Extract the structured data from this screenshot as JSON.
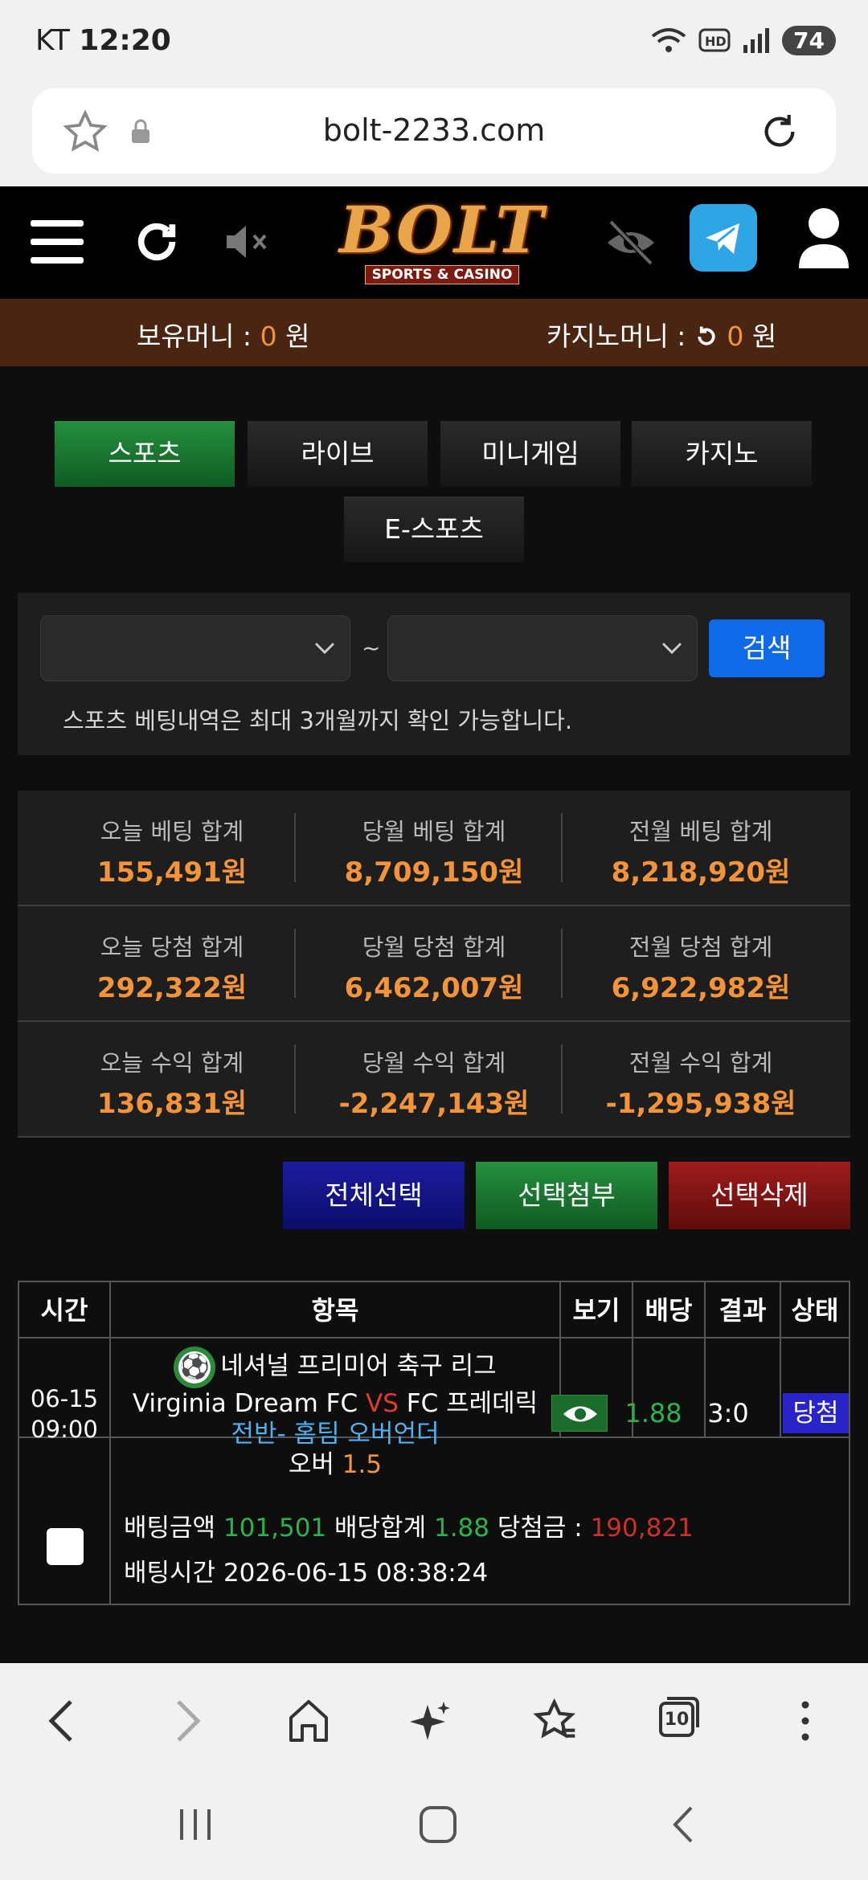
{
  "status": {
    "carrier": "KT",
    "time": "12:20",
    "battery": "74"
  },
  "browser": {
    "url": "bolt-2233.com"
  },
  "logo": {
    "title": "BOLT",
    "subtitle": "SPORTS & CASINO"
  },
  "money": {
    "holding_label": "보유머니 :",
    "holding_value": "0",
    "holding_unit": "원",
    "casino_label": "카지노머니 :",
    "casino_value": "0",
    "casino_unit": "원"
  },
  "tabs": [
    {
      "label": "스포츠",
      "active": true
    },
    {
      "label": "라이브"
    },
    {
      "label": "미니게임"
    },
    {
      "label": "카지노"
    },
    {
      "label": "E-스포츠"
    }
  ],
  "search": {
    "tilde": "~",
    "button": "검색",
    "note": "스포츠 베팅내역은 최대 3개월까지 확인 가능합니다."
  },
  "stats": [
    [
      {
        "label": "오늘 베팅 합계",
        "value": "155,491원"
      },
      {
        "label": "당월 베팅 합계",
        "value": "8,709,150원"
      },
      {
        "label": "전월 베팅 합계",
        "value": "8,218,920원"
      }
    ],
    [
      {
        "label": "오늘 당첨 합계",
        "value": "292,322원"
      },
      {
        "label": "당월 당첨 합계",
        "value": "6,462,007원"
      },
      {
        "label": "전월 당첨 합계",
        "value": "6,922,982원"
      }
    ],
    [
      {
        "label": "오늘 수익 합계",
        "value": "136,831원"
      },
      {
        "label": "당월 수익 합계",
        "value": "-2,247,143원"
      },
      {
        "label": "전월 수익 합계",
        "value": "-1,295,938원"
      }
    ]
  ],
  "actions": {
    "select_all": "전체선택",
    "attach": "선택첨부",
    "delete": "선택삭제"
  },
  "table": {
    "headers": {
      "time": "시간",
      "item": "항목",
      "view": "보기",
      "odds": "배당",
      "result": "결과",
      "status": "상태"
    },
    "row": {
      "date": "06-15",
      "time": "09:00",
      "league": "네셔널 프리미어 축구 리그",
      "home": "Virginia Dream FC",
      "vs": "VS",
      "away": "FC 프레데릭",
      "market": "전반- 홈팀 오버언더",
      "pick": "오버",
      "line": "1.5",
      "odds": "1.88",
      "result": "3:0",
      "status": "당첨"
    },
    "detail": {
      "bet_label": "배팅금액",
      "bet_amount": "101,501",
      "odds_label": "배당합계",
      "odds_total": "1.88",
      "win_label": "당첨금 :",
      "win_amount": "190,821",
      "time_label": "배팅시간",
      "time_value": "2026-06-15 08:38:24"
    }
  },
  "bottom_nav": {
    "tabs_count": "10"
  }
}
